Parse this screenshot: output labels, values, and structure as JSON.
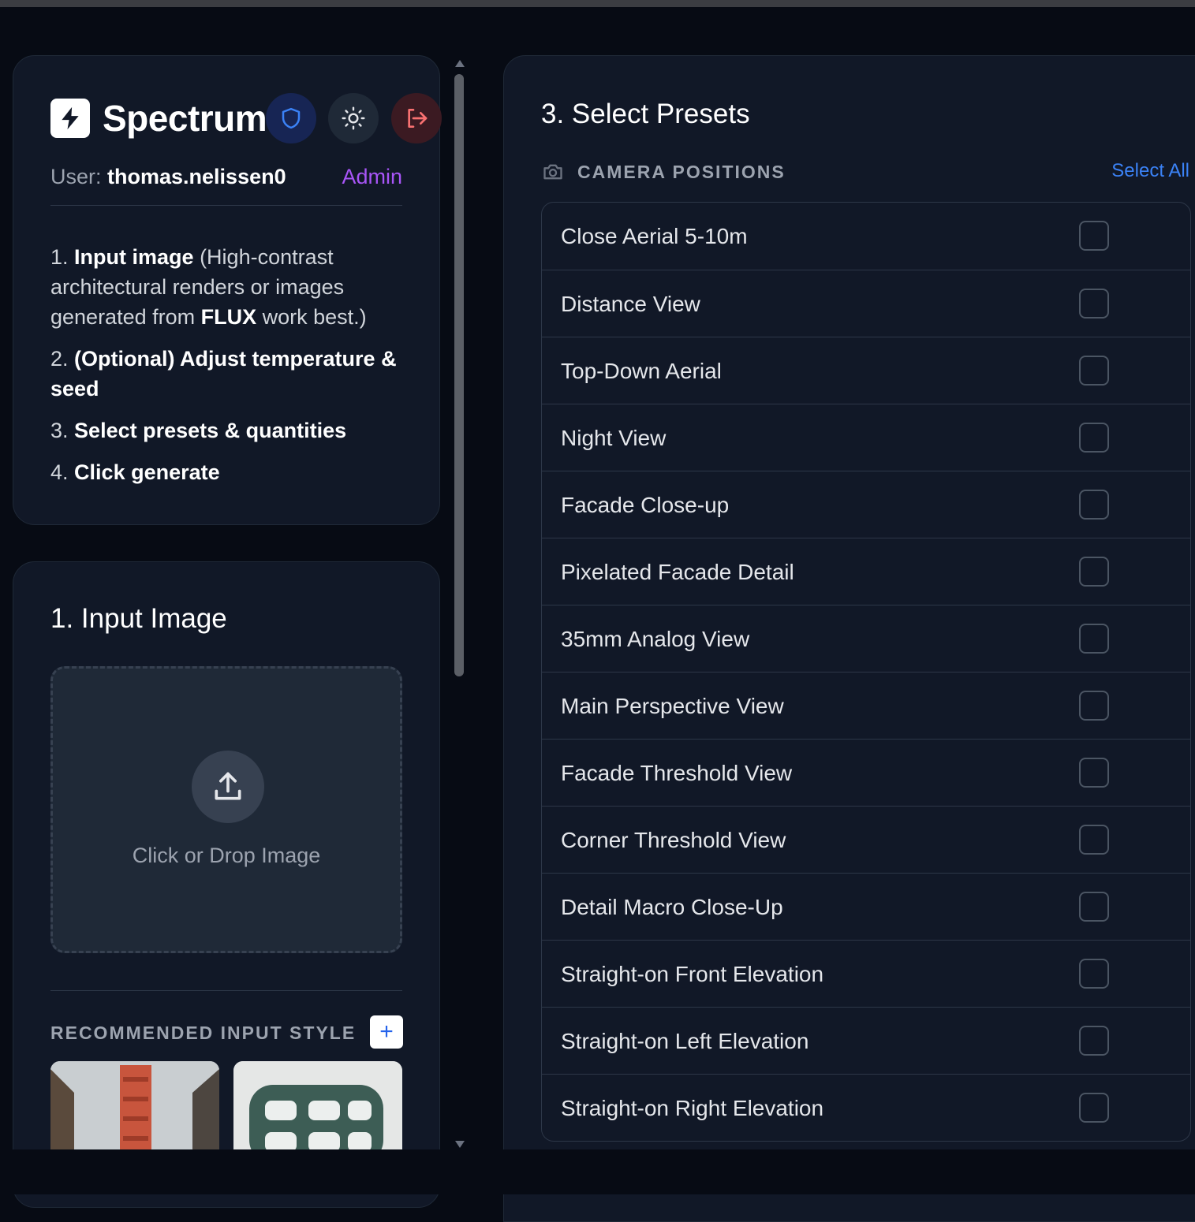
{
  "app": {
    "name": "Spectrum",
    "user_label": "User:",
    "username": "thomas.nelissen0",
    "role": "Admin"
  },
  "instructions": [
    {
      "num": "1.",
      "bold": "Input image",
      "rest": " (High-contrast architectural renders or images generated from ",
      "bold2": "FLUX",
      "rest2": " work best.)"
    },
    {
      "num": "2.",
      "bold": "(Optional) Adjust temperature & seed"
    },
    {
      "num": "3.",
      "bold": "Select presets & quantities"
    },
    {
      "num": "4.",
      "bold": "Click generate"
    }
  ],
  "input_section": {
    "title": "1. Input Image",
    "drop_text": "Click or Drop Image",
    "recommended_label": "RECOMMENDED INPUT STYLE",
    "add_label": "+"
  },
  "presets_section": {
    "title": "3. Select Presets",
    "group_label": "CAMERA POSITIONS",
    "select_all": "Select All",
    "items": [
      {
        "label": "Close Aerial 5-10m",
        "checked": false
      },
      {
        "label": "Distance View",
        "checked": false
      },
      {
        "label": "Top-Down Aerial",
        "checked": false
      },
      {
        "label": "Night View",
        "checked": false
      },
      {
        "label": "Facade Close-up",
        "checked": false
      },
      {
        "label": "Pixelated Facade Detail",
        "checked": false
      },
      {
        "label": "35mm Analog View",
        "checked": false
      },
      {
        "label": "Main Perspective View",
        "checked": false
      },
      {
        "label": "Facade Threshold View",
        "checked": false
      },
      {
        "label": "Corner Threshold View",
        "checked": false
      },
      {
        "label": "Detail Macro Close-Up",
        "checked": false
      },
      {
        "label": "Straight-on Front Elevation",
        "checked": false
      },
      {
        "label": "Straight-on Left Elevation",
        "checked": false
      },
      {
        "label": "Straight-on Right Elevation",
        "checked": false
      }
    ]
  },
  "colors": {
    "background": "#070b14",
    "card": "#111827",
    "accent_blue": "#3b82f6",
    "admin_purple": "#a855f7",
    "logout_red": "#f87171"
  },
  "icons": {
    "logo": "lightning-bolt-icon",
    "admin": "shield-icon",
    "theme": "sun-icon",
    "logout": "logout-icon",
    "upload": "upload-icon",
    "camera": "camera-icon"
  }
}
